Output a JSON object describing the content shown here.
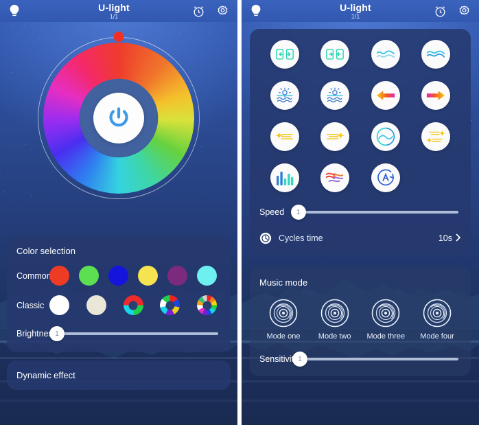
{
  "header": {
    "title": "U-light",
    "subtitle": "1/1",
    "bulb_icon": "bulb-icon",
    "timer_icon": "alarm-clock-icon",
    "settings_icon": "gear-icon"
  },
  "left_panel": {
    "power_button": "power-icon",
    "color_wheel": "color-wheel",
    "color_selection": {
      "title": "Color selection",
      "commonly_label": "Commonly",
      "commonly_colors": [
        "#ee3b24",
        "#5ce052",
        "#1414dd",
        "#f5e34f",
        "#7b2a7e",
        "#6ef0f0"
      ],
      "classic_label": "Classic",
      "classic_items": [
        {
          "name": "white-swatch",
          "type": "solid",
          "color": "#ffffff"
        },
        {
          "name": "warm-white-swatch",
          "type": "solid",
          "color": "#eae7d9"
        },
        {
          "name": "three-color-wheel",
          "type": "wheel",
          "colors": [
            "#ee2b2b",
            "#1fd14a",
            "#19d6e8",
            "#ee2b2b"
          ]
        },
        {
          "name": "seven-color-wheel",
          "type": "wheel",
          "colors": [
            "#ee2222",
            "#1b46e0",
            "#f5d014",
            "#7a1fd6",
            "#19d6e8",
            "#ffffff",
            "#1fd14a"
          ]
        },
        {
          "name": "multi-color-wheel",
          "type": "wheel",
          "colors": [
            "#ee2222",
            "#f08020",
            "#f5d014",
            "#1fd14a",
            "#19d6e8",
            "#1b46e0",
            "#7a1fd6",
            "#e62ec2",
            "#ffffff",
            "#f5a020",
            "#2ec27a",
            "#d0d0d0"
          ]
        }
      ]
    },
    "brightness": {
      "label": "Brightness",
      "value": "1"
    },
    "dynamic_effect": {
      "title": "Dynamic effect"
    }
  },
  "right_panel": {
    "effects": [
      {
        "name": "effect-jump-in-icon",
        "icon": "arrows-in-box"
      },
      {
        "name": "effect-jump-out-icon",
        "icon": "arrows-out-box"
      },
      {
        "name": "effect-single-wave-icon",
        "icon": "wave-single"
      },
      {
        "name": "effect-double-wave-icon",
        "icon": "wave-double"
      },
      {
        "name": "effect-sunrise-icon",
        "icon": "sun-water"
      },
      {
        "name": "effect-sunset-icon",
        "icon": "sun-water-2"
      },
      {
        "name": "effect-flow-left-icon",
        "icon": "arrow-left-gradient"
      },
      {
        "name": "effect-flow-right-icon",
        "icon": "arrow-right-gradient"
      },
      {
        "name": "effect-meteor-left-icon",
        "icon": "star-left"
      },
      {
        "name": "effect-meteor-right-icon",
        "icon": "star-right"
      },
      {
        "name": "effect-breathe-icon",
        "icon": "circle-wave"
      },
      {
        "name": "effect-double-meteor-icon",
        "icon": "double-star"
      },
      {
        "name": "effect-equalizer-icon",
        "icon": "bars"
      },
      {
        "name": "effect-ripple-icon",
        "icon": "ripple-lines"
      },
      {
        "name": "effect-auto-icon",
        "icon": "auto-a"
      }
    ],
    "speed": {
      "label": "Speed",
      "value": "1"
    },
    "cycles_time": {
      "icon": "cycle-icon",
      "label": "Cycles time",
      "value": "10s",
      "chevron": "chevron-right-icon"
    },
    "music_mode": {
      "title": "Music mode",
      "modes": [
        {
          "name": "music-mode-one",
          "label": "Mode one",
          "icon": "vinyl-disc-icon"
        },
        {
          "name": "music-mode-two",
          "label": "Mode two",
          "icon": "vinyl-disc-icon"
        },
        {
          "name": "music-mode-three",
          "label": "Mode three",
          "icon": "vinyl-disc-icon"
        },
        {
          "name": "music-mode-four",
          "label": "Mode four",
          "icon": "vinyl-disc-icon"
        }
      ],
      "sensitivity": {
        "label": "Sensitivity",
        "value": "1"
      }
    }
  },
  "colors": {
    "accent": "#3d9ae8",
    "card_bg": "#26396e",
    "header_bg": "#3258b0",
    "handle": "#ee3124"
  }
}
